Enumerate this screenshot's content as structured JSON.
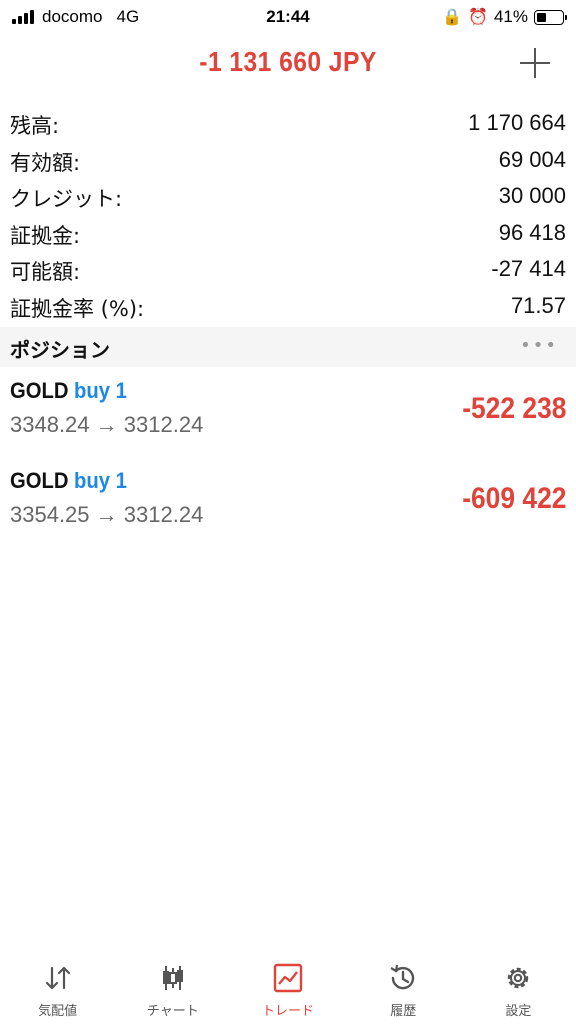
{
  "status_bar": {
    "carrier": "docomo",
    "network": "4G",
    "time": "21:44",
    "battery": "41%",
    "battery_level": 0.41
  },
  "header": {
    "total": "-1 131 660 JPY",
    "add_icon": "plus-icon"
  },
  "summary": [
    {
      "label": "残高:",
      "value": "1 170 664"
    },
    {
      "label": "有効額:",
      "value": "69 004"
    },
    {
      "label": "クレジット:",
      "value": "30 000"
    },
    {
      "label": "証拠金:",
      "value": "96 418"
    },
    {
      "label": "可能額:",
      "value": "-27 414"
    },
    {
      "label": "証拠金率 (%):",
      "value": "71.57"
    }
  ],
  "positions_section": {
    "title": "ポジション",
    "more": "•••"
  },
  "positions": [
    {
      "symbol": "GOLD",
      "direction": "buy 1",
      "open_price": "3348.24",
      "arrow": "→",
      "current_price": "3312.24",
      "profit": "-522 238"
    },
    {
      "symbol": "GOLD",
      "direction": "buy 1",
      "open_price": "3354.25",
      "arrow": "→",
      "current_price": "3312.24",
      "profit": "-609 422"
    }
  ],
  "tabs": [
    {
      "label": "気配値",
      "icon": "quotes-icon"
    },
    {
      "label": "チャート",
      "icon": "chart-icon"
    },
    {
      "label": "トレード",
      "icon": "trade-icon"
    },
    {
      "label": "履歴",
      "icon": "history-icon"
    },
    {
      "label": "設定",
      "icon": "settings-icon"
    }
  ],
  "colors": {
    "negative": "#e0433a",
    "buy": "#1e88e5",
    "active_tab": "#e0433a"
  }
}
